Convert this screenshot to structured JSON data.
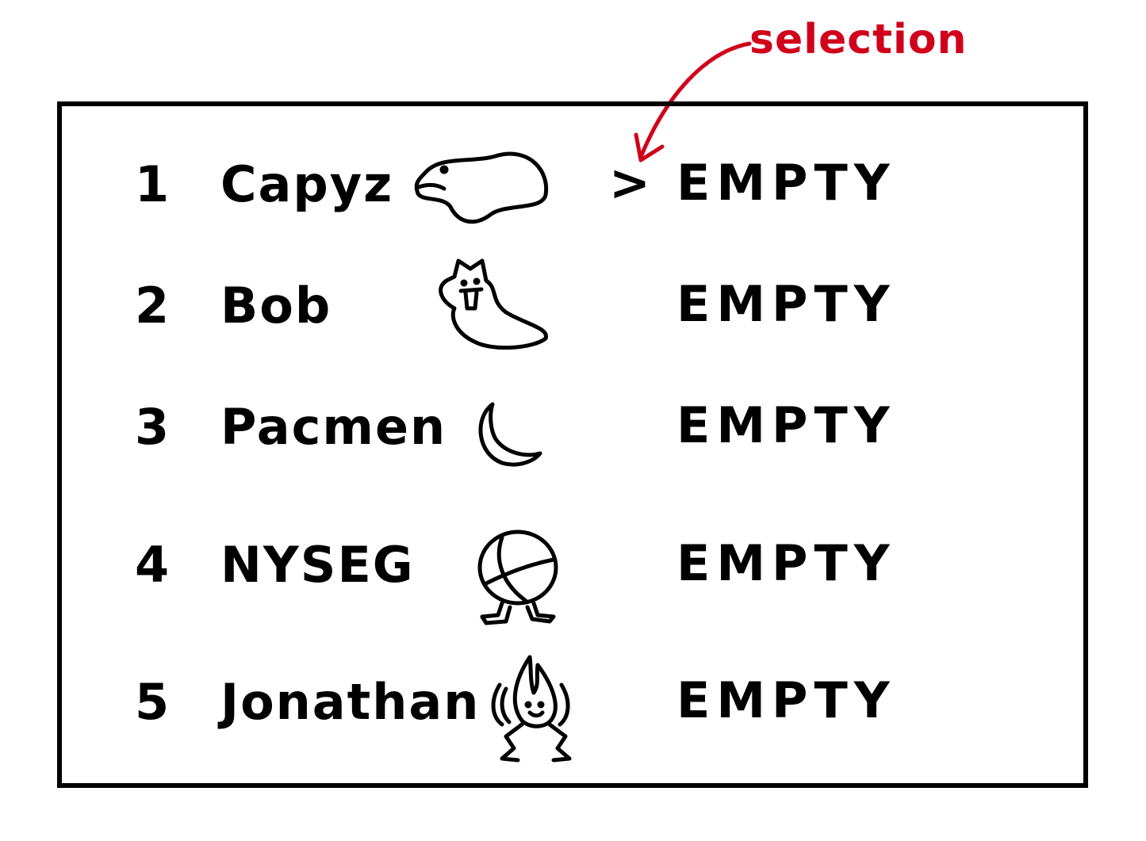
{
  "annotation": {
    "label": "selection",
    "color": "#d0021b"
  },
  "cursor": {
    "glyph": ">"
  },
  "slots": [
    {
      "number": "1",
      "name": "Capyz",
      "status": "EMPTY",
      "creature_icon": "blob-creature-icon",
      "selected": true
    },
    {
      "number": "2",
      "name": "Bob",
      "status": "EMPTY",
      "creature_icon": "ghost-tongue-creature-icon",
      "selected": false
    },
    {
      "number": "3",
      "name": "Pacmen",
      "status": "EMPTY",
      "creature_icon": "crescent-moon-creature-icon",
      "selected": false
    },
    {
      "number": "4",
      "name": "NYSEG",
      "status": "EMPTY",
      "creature_icon": "ball-with-feet-creature-icon",
      "selected": false
    },
    {
      "number": "5",
      "name": "Jonathan",
      "status": "EMPTY",
      "creature_icon": "flame-dancer-creature-icon",
      "selected": false
    }
  ]
}
